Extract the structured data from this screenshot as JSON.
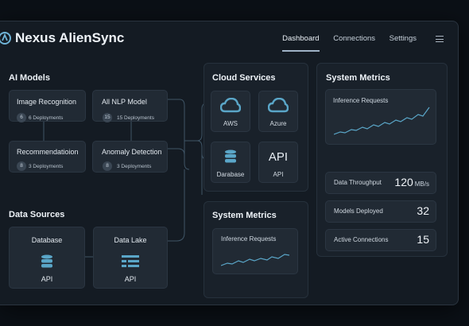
{
  "app": {
    "title": "Nexus AlienSync"
  },
  "nav": {
    "items": [
      "Dashboard",
      "Connections",
      "Settings"
    ],
    "active": "Dashboard"
  },
  "ai_models": {
    "title": "AI Models",
    "cards": [
      {
        "title": "Image Recognition",
        "badge": "6",
        "deployments": "6 Deployments"
      },
      {
        "title": "All NLP Model",
        "badge": "15",
        "deployments": "15 Deployments"
      },
      {
        "title": "Recommendatioion",
        "badge": "8",
        "deployments": "3 Deployments"
      },
      {
        "title": "Anomaly Detection",
        "badge": "8",
        "deployments": "3 Deployments"
      }
    ]
  },
  "cloud_services": {
    "title": "Cloud Services",
    "items": [
      {
        "label": "AWS",
        "icon": "cloud-icon"
      },
      {
        "label": "Azure",
        "icon": "cloud-icon"
      },
      {
        "label": "Darabase",
        "icon": "database-icon"
      },
      {
        "label": "API",
        "icon_text": "API"
      }
    ]
  },
  "data_sources": {
    "title": "Data Sources",
    "items": [
      {
        "title": "Database",
        "label": "API",
        "icon": "database-icon"
      },
      {
        "title": "Data Lake",
        "label": "API",
        "icon": "table-icon"
      }
    ]
  },
  "system_metrics_small": {
    "title": "System Metrics",
    "chart_label": "Inference Requests"
  },
  "system_metrics": {
    "title": "System Metrics",
    "chart_label": "Inference Requests",
    "rows": [
      {
        "label": "Data Throughput",
        "value": "120",
        "unit": "MB/s"
      },
      {
        "label": "Models Deployed",
        "value": "32",
        "unit": ""
      },
      {
        "label": "Active Connections",
        "value": "15",
        "unit": ""
      }
    ]
  },
  "colors": {
    "accent": "#5aa6c8",
    "background": "#0b1016",
    "panel": "#19212a",
    "card": "#212a34"
  }
}
